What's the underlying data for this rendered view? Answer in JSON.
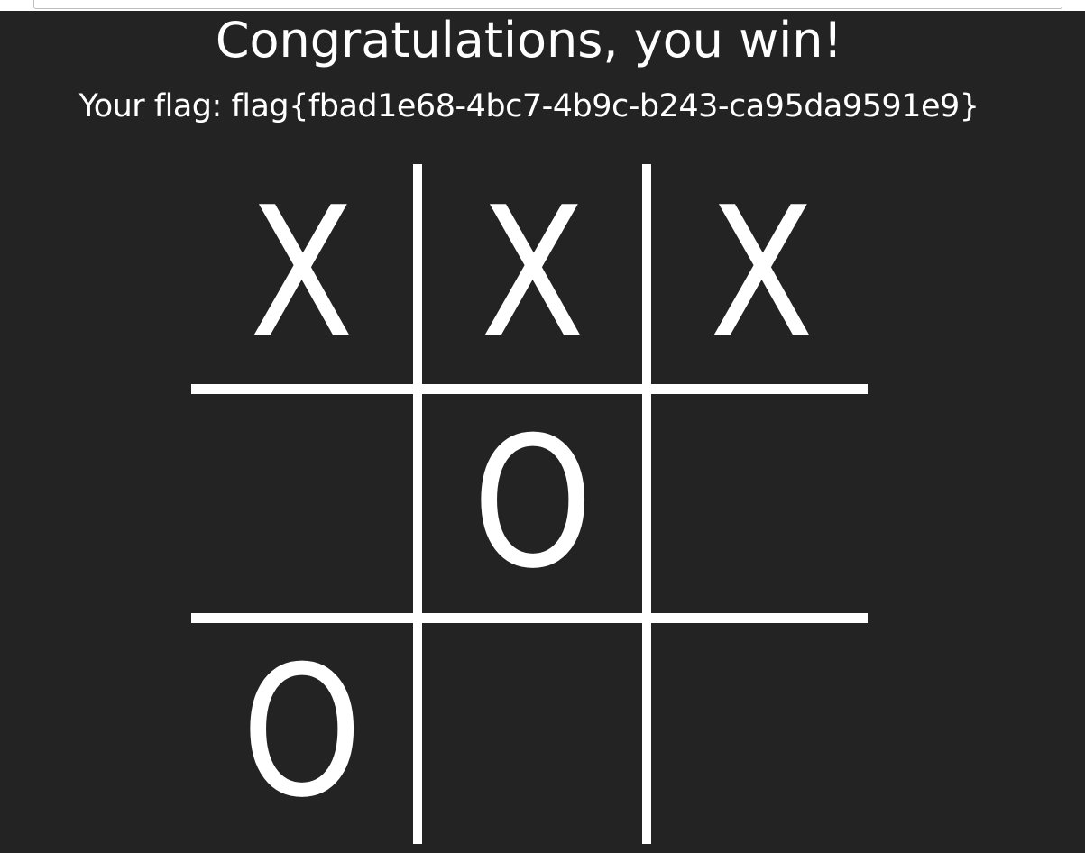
{
  "header": {
    "title": "Congratulations, you win!",
    "flag_text": "Your flag: flag{fbad1e68-4bc7-4b9c-b243-ca95da9591e9}"
  },
  "board": {
    "cells": [
      "X",
      "X",
      "X",
      "",
      "O",
      "",
      "O",
      "",
      ""
    ]
  },
  "colors": {
    "background": "#232323",
    "foreground": "#ffffff"
  }
}
